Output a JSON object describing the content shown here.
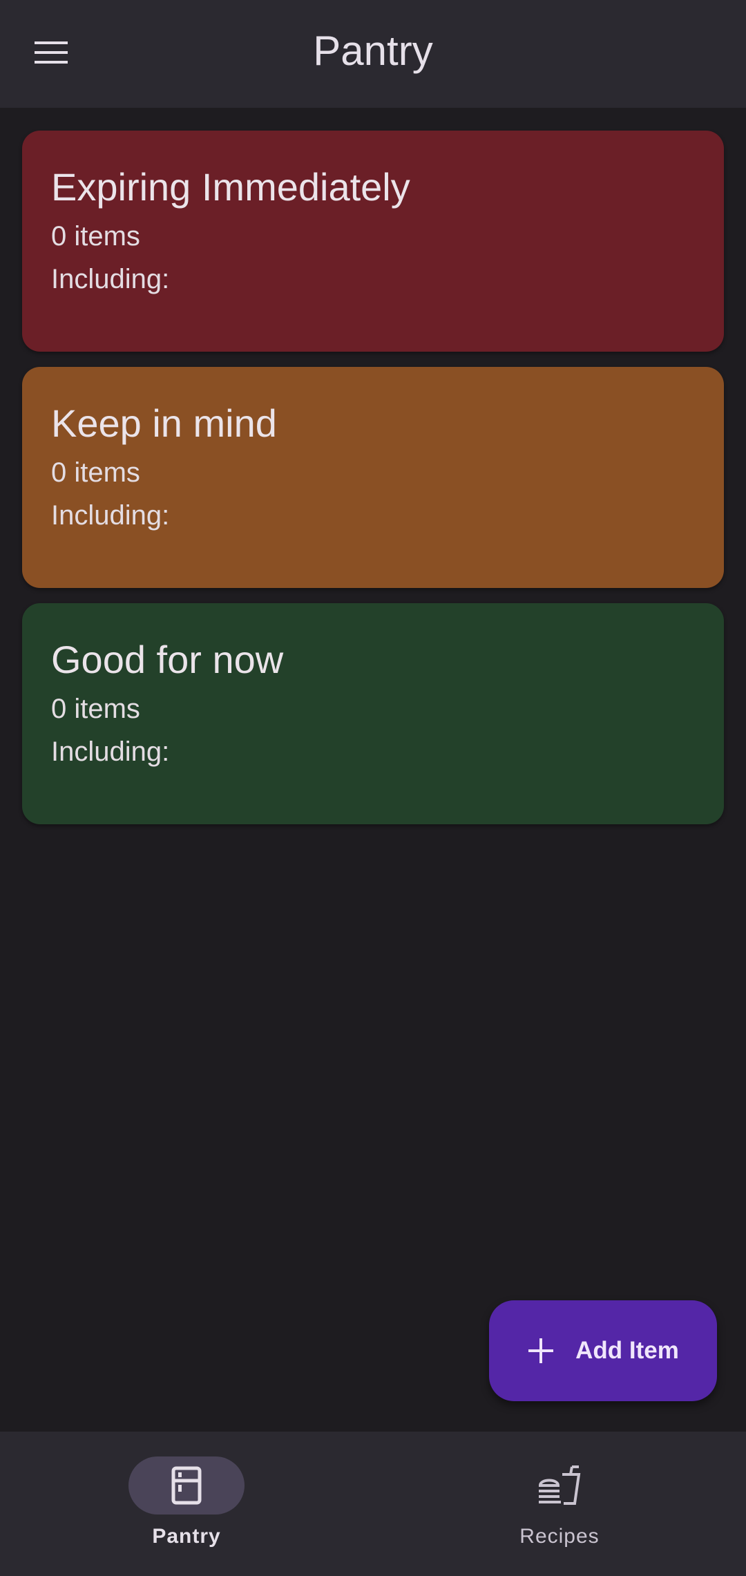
{
  "app_bar": {
    "title": "Pantry",
    "menu_icon": "menu-icon"
  },
  "cards": [
    {
      "title": "Expiring Immediately",
      "count": "0 items",
      "including": "Including:",
      "color": "#6b1f27"
    },
    {
      "title": "Keep in mind",
      "count": "0 items",
      "including": "Including:",
      "color": "#8a5024"
    },
    {
      "title": "Good for now",
      "count": "0 items",
      "including": "Including:",
      "color": "#23412a"
    }
  ],
  "fab": {
    "label": "Add Item",
    "icon": "plus-icon",
    "color": "#5426a7"
  },
  "bottom_nav": {
    "items": [
      {
        "label": "Pantry",
        "icon": "fridge-icon",
        "active": true
      },
      {
        "label": "Recipes",
        "icon": "food-icon",
        "active": false
      }
    ]
  },
  "colors": {
    "background": "#1e1c20",
    "surface": "#2b2930",
    "on_surface": "#e6e0e9",
    "active_indicator": "#4a4458"
  }
}
